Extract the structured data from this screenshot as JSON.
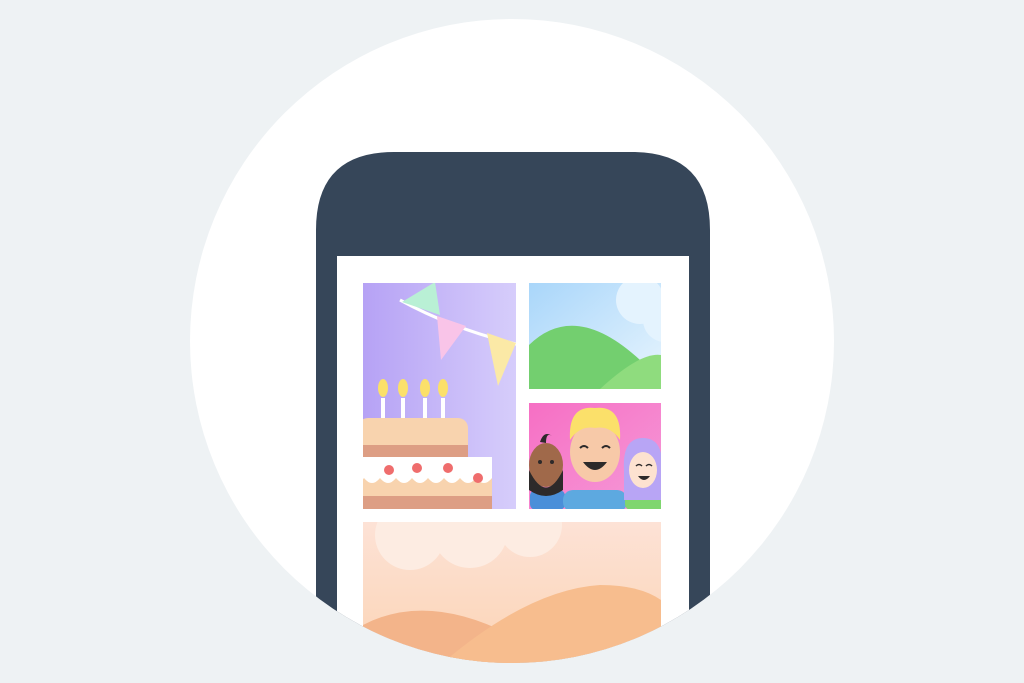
{
  "illustration": {
    "subject": "phone-photo-gallery",
    "palette": {
      "background": "#eef2f4",
      "circle": "#ffffff",
      "phone_body": "#364659",
      "screen": "#ffffff",
      "party_bg_left": "#b8a5f5",
      "party_bg_right": "#d5cbfb",
      "bunting": [
        "#b9f0d5",
        "#f9c4e8",
        "#fbe9a6"
      ],
      "cake_top": "#f8d3ae",
      "cake_layer": "#dd9e84",
      "cake_frosting": "#ffffff",
      "cake_dots": "#ef6d6d",
      "candle_flame": "#fbe06a",
      "landscape_sky": "#bfe3fb",
      "landscape_hill": "#73cf6f",
      "group_bg": "#f56ec3",
      "desert_sky": "#fde6d6",
      "desert_dune": "#f6b88b"
    },
    "tiles": [
      {
        "id": "birthday-party-photo",
        "icon": "cake-icon"
      },
      {
        "id": "landscape-photo",
        "icon": "hills-icon"
      },
      {
        "id": "group-selfie-photo",
        "icon": "people-icon"
      },
      {
        "id": "desert-photo",
        "icon": "dunes-icon"
      }
    ]
  }
}
